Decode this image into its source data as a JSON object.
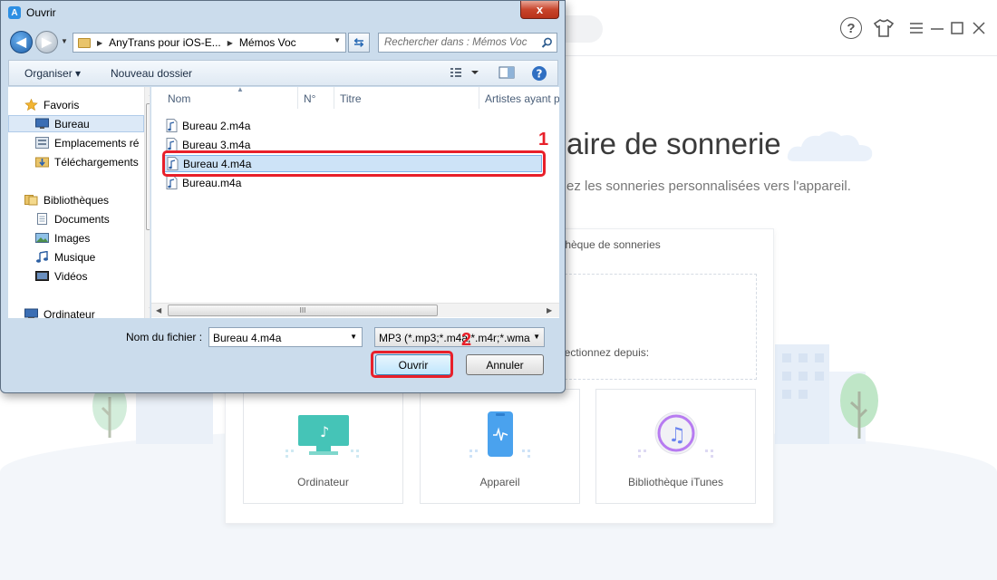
{
  "app": {
    "title": "aire de sonnerie",
    "subtitle": "ez les sonneries personnalisées vers l'appareil.",
    "tab_label": "thèque de sonneries",
    "drop_text": "lectionnez depuis:",
    "cards": [
      {
        "label": "Ordinateur",
        "icon": "computer-icon"
      },
      {
        "label": "Appareil",
        "icon": "phone-icon"
      },
      {
        "label": "Bibliothèque iTunes",
        "icon": "itunes-icon"
      }
    ],
    "help_glyph": "?",
    "accent_color": "#3fc6b5"
  },
  "dialog": {
    "title": "Ouvrir",
    "close_glyph": "x",
    "address": {
      "crumbs": [
        "AnyTrans pour iOS-E...",
        "Mémos Voc"
      ]
    },
    "search_placeholder": "Rechercher dans : Mémos Voc",
    "toolbar": {
      "organize": "Organiser ▾",
      "new_folder": "Nouveau dossier"
    },
    "nav": {
      "favorites": "Favoris",
      "desktop": "Bureau",
      "recent": "Emplacements ré",
      "downloads": "Téléchargements",
      "libraries": "Bibliothèques",
      "documents": "Documents",
      "pictures": "Images",
      "music": "Musique",
      "videos": "Vidéos",
      "computer": "Ordinateur"
    },
    "columns": [
      "Nom",
      "N°",
      "Titre",
      "Artistes ayant pa"
    ],
    "files": [
      "Bureau 2.m4a",
      "Bureau 3.m4a",
      "Bureau 4.m4a",
      "Bureau.m4a"
    ],
    "selected_file": "Bureau 4.m4a",
    "filename_label": "Nom du fichier :",
    "filename_value": "Bureau 4.m4a",
    "filetype_value": "MP3 (*.mp3;*.m4a;*.m4r;*.wma",
    "open_label": "Ouvrir",
    "cancel_label": "Annuler",
    "scroll_grip": "III"
  },
  "annotations": {
    "step1": "1",
    "step2": "2",
    "highlight_color": "#e8202a"
  }
}
